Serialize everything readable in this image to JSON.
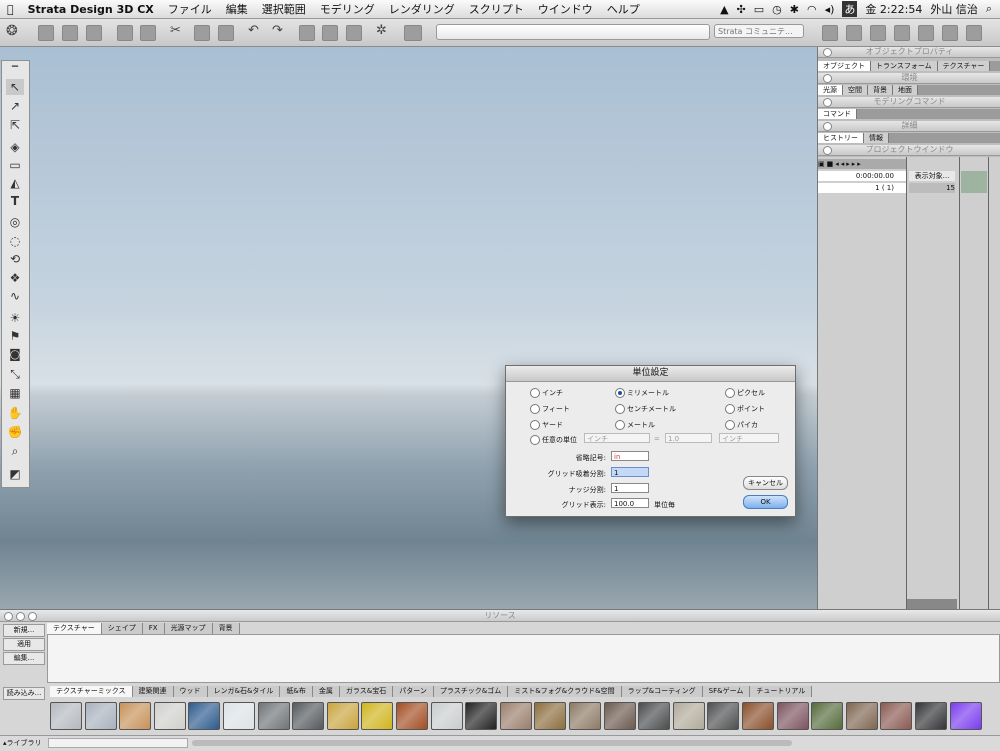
{
  "menubar": {
    "app_name": "Strata Design 3D CX",
    "items": [
      "ファイル",
      "編集",
      "選択範囲",
      "モデリング",
      "レンダリング",
      "スクリプト",
      "ウインドウ",
      "ヘルプ"
    ],
    "input_indicator": "あ",
    "clock": "金 2:22:54",
    "user": "外山 信治"
  },
  "toolbar": {
    "search_select": "Strata コミュニテ..."
  },
  "right_panels": {
    "object_properties": {
      "title": "オブジェクトプロパティ",
      "tabs": [
        "オブジェクト",
        "トランスフォーム",
        "テクスチャー"
      ]
    },
    "environment": {
      "title": "環境",
      "tabs": [
        "光源",
        "空間",
        "背景",
        "地面"
      ]
    },
    "modeling_command": {
      "title": "モデリングコマンド",
      "tabs": [
        "コマンド"
      ]
    },
    "details": {
      "title": "詳細",
      "tabs": [
        "ヒストリー",
        "情報"
      ]
    },
    "project_window": {
      "title": "プロジェクトウインドウ",
      "time": "0:00:00.00",
      "frame": "1 ( 1)",
      "display_object": "表示対象...",
      "frame_marker": "15"
    }
  },
  "dialog": {
    "title": "単位設定",
    "units_col1": [
      "インチ",
      "フィート",
      "ヤード"
    ],
    "units_col2": [
      "ミリメートル",
      "センチメートル",
      "メートル"
    ],
    "units_col3": [
      "ピクセル",
      "ポイント",
      "パイカ"
    ],
    "selected_unit": "ミリメートル",
    "custom_unit": {
      "label": "任意の単位",
      "value": "インチ",
      "equals": "=",
      "ratio": "1.0",
      "select": "インチ"
    },
    "abbreviation": {
      "label": "省略記号:",
      "value": "in"
    },
    "grid_snap": {
      "label": "グリッド吸着分割:",
      "value": "1"
    },
    "nudge": {
      "label": "ナッジ分割:",
      "value": "1"
    },
    "grid_display": {
      "label": "グリッド表示:",
      "value": "100.0",
      "unit": "単位毎"
    },
    "cancel_label": "キャンセル",
    "ok_label": "OK"
  },
  "resources": {
    "title": "リソース",
    "side_buttons": [
      "新規...",
      "適用",
      "編集..."
    ],
    "load_label": "読み込み...",
    "library_label": "ライブラリ",
    "top_tabs": [
      "テクスチャー",
      "シェイプ",
      "FX",
      "光源マップ",
      "背景"
    ],
    "category_tabs": [
      "テクスチャーミックス",
      "建築関連",
      "ウッド",
      "レンガ&石&タイル",
      "紙&布",
      "金属",
      "ガラス&宝石",
      "パターン",
      "プラスチック&ゴム",
      "ミスト&フォグ&クラウド&空間",
      "ラップ&コーティング",
      "SF&ゲーム",
      "チュートリアル"
    ],
    "swatch_colors": [
      "#b4b9bf",
      "#a8b1bd",
      "#c6925a",
      "#cfd0cc",
      "#2d5b8e",
      "#dce2e6",
      "#6f7478",
      "#55595d",
      "#c9a43e",
      "#cfb41c",
      "#a34d22",
      "#c9cccd",
      "#222222",
      "#9a7e6c",
      "#8c6d3e",
      "#8d7a66",
      "#6b5a4e",
      "#4a4c4e",
      "#b0aa9a",
      "#4e4f50",
      "#8a4e2a",
      "#7d5460",
      "#556b3c",
      "#7e6650",
      "#8a5a52",
      "#333437",
      "#7a3cf0"
    ]
  }
}
